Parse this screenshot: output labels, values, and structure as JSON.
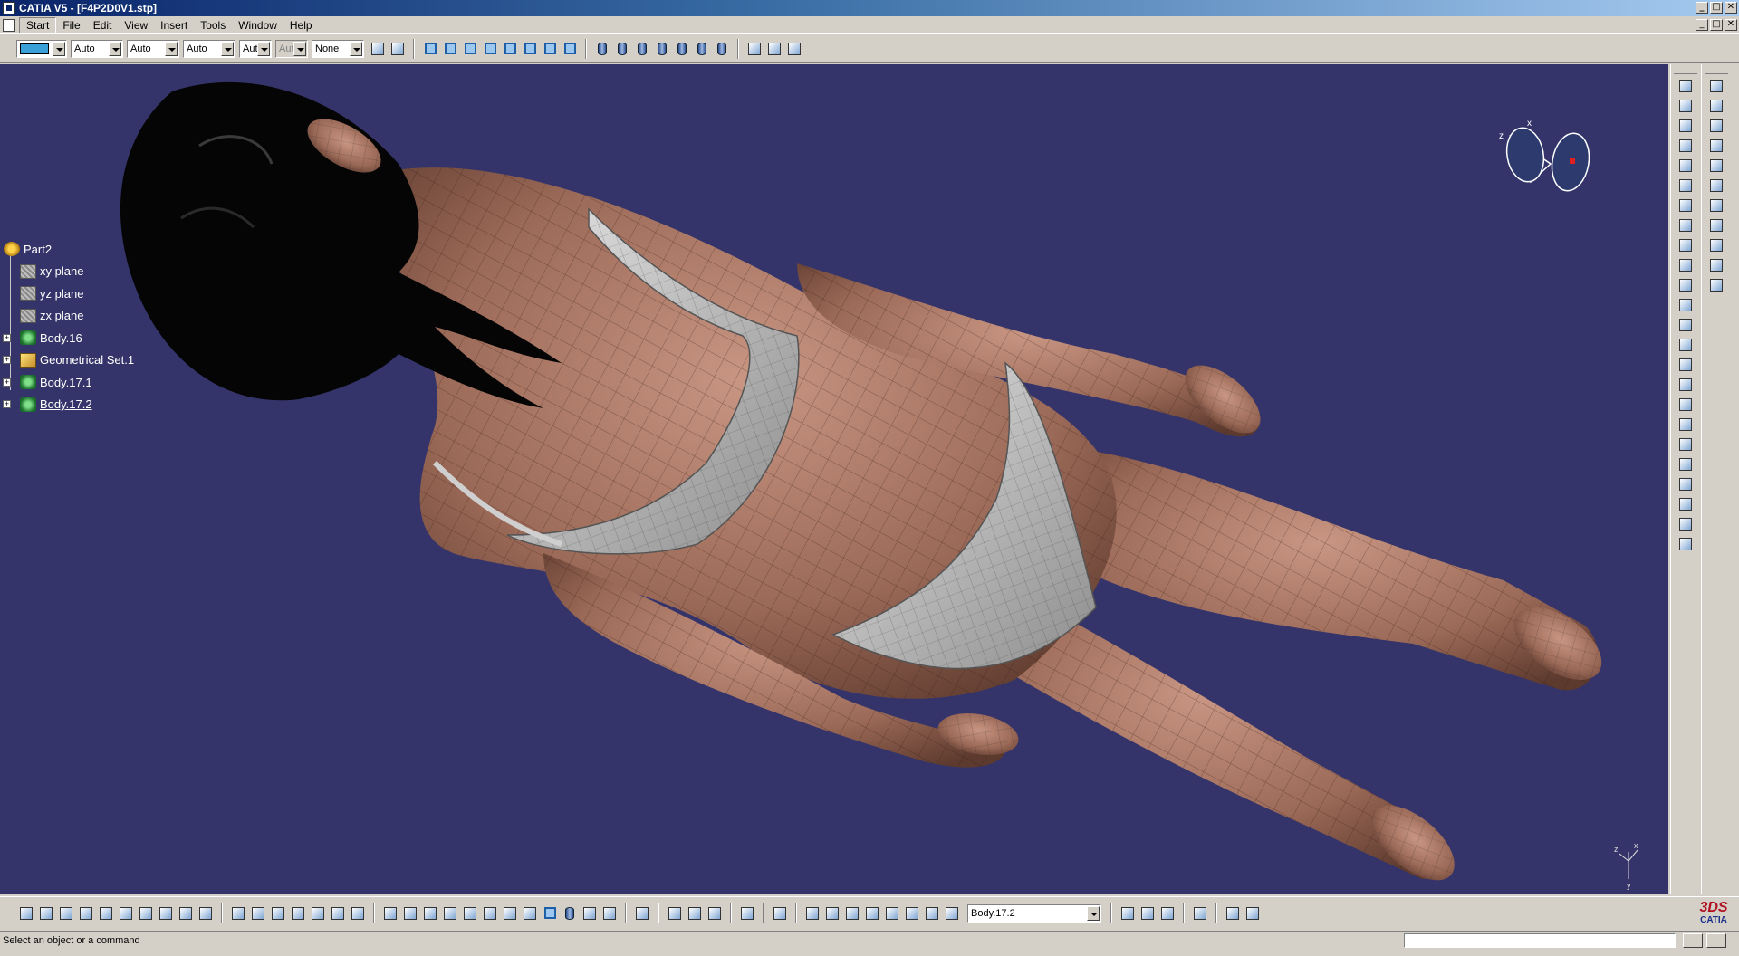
{
  "window": {
    "title": "CATIA V5 - [F4P2D0V1.stp]",
    "controls": [
      "_",
      "□",
      "✕"
    ]
  },
  "menubar": {
    "items": [
      "Start",
      "File",
      "Edit",
      "View",
      "Insert",
      "Tools",
      "Window",
      "Help"
    ]
  },
  "graphic_properties": {
    "fill_color": "#3aa0d8",
    "line_type": "Auto",
    "line_thickness": "Auto",
    "point_symbol": "Auto",
    "rendering_style": "Aut",
    "layer_disabled": "Aut",
    "layer": "None"
  },
  "tree": {
    "root": "Part2",
    "children": [
      {
        "label": "xy plane",
        "icon": "plane-icon"
      },
      {
        "label": "yz plane",
        "icon": "plane-icon"
      },
      {
        "label": "zx plane",
        "icon": "plane-icon"
      },
      {
        "label": "Body.16",
        "icon": "body-icon",
        "expandable": true
      },
      {
        "label": "Geometrical Set.1",
        "icon": "geometrical-set-icon",
        "expandable": true
      },
      {
        "label": "Body.17.1",
        "icon": "body-icon",
        "expandable": true
      },
      {
        "label": "Body.17.2",
        "icon": "body-icon",
        "expandable": true,
        "selected": true
      }
    ]
  },
  "compass": {
    "x_label": "x",
    "z_label": "z"
  },
  "axis_triad": {
    "x_label": "x",
    "y_label": "y",
    "z_label": "z"
  },
  "current_body": {
    "value": "Body.17.2"
  },
  "status": {
    "message": "Select an object or a command"
  },
  "brand": {
    "logo_text": "CATIA",
    "mark": "3DS"
  },
  "colors": {
    "viewport_bg": "#34346a",
    "skin": "#9c6a58",
    "garment": "#b8b8b8",
    "hair": "#050505"
  }
}
